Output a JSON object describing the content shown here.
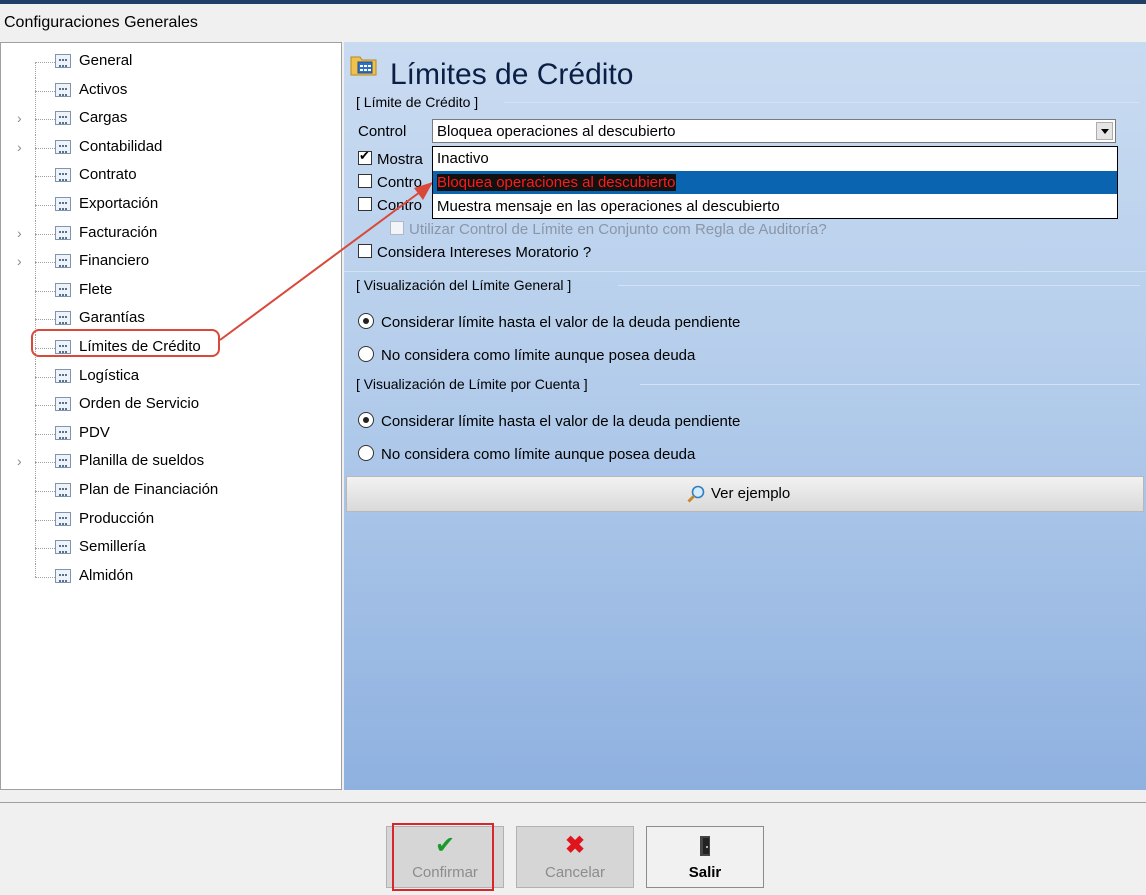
{
  "window": {
    "title": "Configuraciones Generales"
  },
  "tree": {
    "items": [
      {
        "label": "General",
        "expandable": false
      },
      {
        "label": "Activos",
        "expandable": false
      },
      {
        "label": "Cargas",
        "expandable": true
      },
      {
        "label": "Contabilidad",
        "expandable": true
      },
      {
        "label": "Contrato",
        "expandable": false
      },
      {
        "label": "Exportación",
        "expandable": false
      },
      {
        "label": "Facturación",
        "expandable": true
      },
      {
        "label": "Financiero",
        "expandable": true
      },
      {
        "label": "Flete",
        "expandable": false
      },
      {
        "label": "Garantías",
        "expandable": false
      },
      {
        "label": "Límites de Crédito",
        "expandable": false,
        "selected": true
      },
      {
        "label": "Logística",
        "expandable": false
      },
      {
        "label": "Orden de Servicio",
        "expandable": false
      },
      {
        "label": "PDV",
        "expandable": false
      },
      {
        "label": "Planilla de sueldos",
        "expandable": true
      },
      {
        "label": "Plan de Financiación",
        "expandable": false
      },
      {
        "label": "Producción",
        "expandable": false
      },
      {
        "label": "Semillería",
        "expandable": false
      },
      {
        "label": "Almidón",
        "expandable": false
      }
    ]
  },
  "panel": {
    "title": "Límites de Crédito",
    "credit_group": "[ Límite de Crédito ]",
    "control_label": "Control",
    "control_value": "Bloquea operaciones al descubierto",
    "dropdown_options": [
      "Inactivo",
      "Bloquea operaciones al descubierto",
      "Muestra mensaje en las operaciones al descubierto"
    ],
    "checkbox_mostrar": "Mostra",
    "checkbox_control1": "Contro",
    "checkbox_control2": "Contro",
    "checkbox_auditoria": "Utilizar Control de Límite en Conjunto com Regla de Auditoría?",
    "checkbox_intereses": "Considera Intereses Moratorio ?",
    "general_group": "[ Visualización del Límite General ]",
    "general_opt1": "Considerar límite hasta el valor de la deuda pendiente",
    "general_opt2": "No considera como límite aunque posea deuda",
    "account_group": "[ Visualización de Límite por Cuenta ]",
    "account_opt1": "Considerar límite hasta el valor de la deuda pendiente",
    "account_opt2": "No considera como límite aunque posea deuda",
    "example_button": "Ver ejemplo"
  },
  "footer": {
    "confirm": "Confirmar",
    "cancel": "Cancelar",
    "exit": "Salir"
  },
  "colors": {
    "highlight": "#d9493a",
    "selection": "#0a64b0",
    "confirm_check": "#1a9a2a",
    "cancel_x": "#e0141c"
  }
}
